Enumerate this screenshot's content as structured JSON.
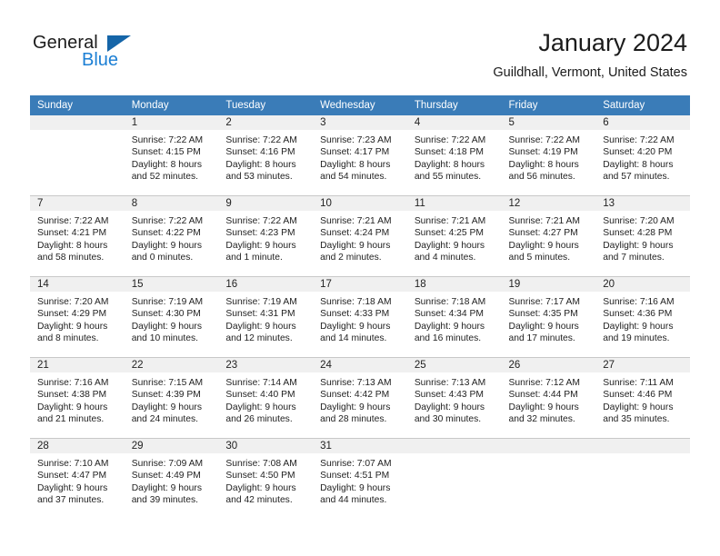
{
  "brand": {
    "name_part1": "General",
    "name_part2": "Blue",
    "triangle_icon": "triangle-icon",
    "accent_dark": "#1565a8",
    "accent_light": "#1b7fd4"
  },
  "header": {
    "title": "January 2024",
    "subtitle": "Guildhall, Vermont, United States",
    "header_bg": "#3a7cb8"
  },
  "weekday_headers": [
    "Sunday",
    "Monday",
    "Tuesday",
    "Wednesday",
    "Thursday",
    "Friday",
    "Saturday"
  ],
  "weeks": [
    [
      {
        "day": "",
        "sunrise": "",
        "sunset": "",
        "daylight_line1": "",
        "daylight_line2": ""
      },
      {
        "day": "1",
        "sunrise": "Sunrise: 7:22 AM",
        "sunset": "Sunset: 4:15 PM",
        "daylight_line1": "Daylight: 8 hours",
        "daylight_line2": "and 52 minutes."
      },
      {
        "day": "2",
        "sunrise": "Sunrise: 7:22 AM",
        "sunset": "Sunset: 4:16 PM",
        "daylight_line1": "Daylight: 8 hours",
        "daylight_line2": "and 53 minutes."
      },
      {
        "day": "3",
        "sunrise": "Sunrise: 7:23 AM",
        "sunset": "Sunset: 4:17 PM",
        "daylight_line1": "Daylight: 8 hours",
        "daylight_line2": "and 54 minutes."
      },
      {
        "day": "4",
        "sunrise": "Sunrise: 7:22 AM",
        "sunset": "Sunset: 4:18 PM",
        "daylight_line1": "Daylight: 8 hours",
        "daylight_line2": "and 55 minutes."
      },
      {
        "day": "5",
        "sunrise": "Sunrise: 7:22 AM",
        "sunset": "Sunset: 4:19 PM",
        "daylight_line1": "Daylight: 8 hours",
        "daylight_line2": "and 56 minutes."
      },
      {
        "day": "6",
        "sunrise": "Sunrise: 7:22 AM",
        "sunset": "Sunset: 4:20 PM",
        "daylight_line1": "Daylight: 8 hours",
        "daylight_line2": "and 57 minutes."
      }
    ],
    [
      {
        "day": "7",
        "sunrise": "Sunrise: 7:22 AM",
        "sunset": "Sunset: 4:21 PM",
        "daylight_line1": "Daylight: 8 hours",
        "daylight_line2": "and 58 minutes."
      },
      {
        "day": "8",
        "sunrise": "Sunrise: 7:22 AM",
        "sunset": "Sunset: 4:22 PM",
        "daylight_line1": "Daylight: 9 hours",
        "daylight_line2": "and 0 minutes."
      },
      {
        "day": "9",
        "sunrise": "Sunrise: 7:22 AM",
        "sunset": "Sunset: 4:23 PM",
        "daylight_line1": "Daylight: 9 hours",
        "daylight_line2": "and 1 minute."
      },
      {
        "day": "10",
        "sunrise": "Sunrise: 7:21 AM",
        "sunset": "Sunset: 4:24 PM",
        "daylight_line1": "Daylight: 9 hours",
        "daylight_line2": "and 2 minutes."
      },
      {
        "day": "11",
        "sunrise": "Sunrise: 7:21 AM",
        "sunset": "Sunset: 4:25 PM",
        "daylight_line1": "Daylight: 9 hours",
        "daylight_line2": "and 4 minutes."
      },
      {
        "day": "12",
        "sunrise": "Sunrise: 7:21 AM",
        "sunset": "Sunset: 4:27 PM",
        "daylight_line1": "Daylight: 9 hours",
        "daylight_line2": "and 5 minutes."
      },
      {
        "day": "13",
        "sunrise": "Sunrise: 7:20 AM",
        "sunset": "Sunset: 4:28 PM",
        "daylight_line1": "Daylight: 9 hours",
        "daylight_line2": "and 7 minutes."
      }
    ],
    [
      {
        "day": "14",
        "sunrise": "Sunrise: 7:20 AM",
        "sunset": "Sunset: 4:29 PM",
        "daylight_line1": "Daylight: 9 hours",
        "daylight_line2": "and 8 minutes."
      },
      {
        "day": "15",
        "sunrise": "Sunrise: 7:19 AM",
        "sunset": "Sunset: 4:30 PM",
        "daylight_line1": "Daylight: 9 hours",
        "daylight_line2": "and 10 minutes."
      },
      {
        "day": "16",
        "sunrise": "Sunrise: 7:19 AM",
        "sunset": "Sunset: 4:31 PM",
        "daylight_line1": "Daylight: 9 hours",
        "daylight_line2": "and 12 minutes."
      },
      {
        "day": "17",
        "sunrise": "Sunrise: 7:18 AM",
        "sunset": "Sunset: 4:33 PM",
        "daylight_line1": "Daylight: 9 hours",
        "daylight_line2": "and 14 minutes."
      },
      {
        "day": "18",
        "sunrise": "Sunrise: 7:18 AM",
        "sunset": "Sunset: 4:34 PM",
        "daylight_line1": "Daylight: 9 hours",
        "daylight_line2": "and 16 minutes."
      },
      {
        "day": "19",
        "sunrise": "Sunrise: 7:17 AM",
        "sunset": "Sunset: 4:35 PM",
        "daylight_line1": "Daylight: 9 hours",
        "daylight_line2": "and 17 minutes."
      },
      {
        "day": "20",
        "sunrise": "Sunrise: 7:16 AM",
        "sunset": "Sunset: 4:36 PM",
        "daylight_line1": "Daylight: 9 hours",
        "daylight_line2": "and 19 minutes."
      }
    ],
    [
      {
        "day": "21",
        "sunrise": "Sunrise: 7:16 AM",
        "sunset": "Sunset: 4:38 PM",
        "daylight_line1": "Daylight: 9 hours",
        "daylight_line2": "and 21 minutes."
      },
      {
        "day": "22",
        "sunrise": "Sunrise: 7:15 AM",
        "sunset": "Sunset: 4:39 PM",
        "daylight_line1": "Daylight: 9 hours",
        "daylight_line2": "and 24 minutes."
      },
      {
        "day": "23",
        "sunrise": "Sunrise: 7:14 AM",
        "sunset": "Sunset: 4:40 PM",
        "daylight_line1": "Daylight: 9 hours",
        "daylight_line2": "and 26 minutes."
      },
      {
        "day": "24",
        "sunrise": "Sunrise: 7:13 AM",
        "sunset": "Sunset: 4:42 PM",
        "daylight_line1": "Daylight: 9 hours",
        "daylight_line2": "and 28 minutes."
      },
      {
        "day": "25",
        "sunrise": "Sunrise: 7:13 AM",
        "sunset": "Sunset: 4:43 PM",
        "daylight_line1": "Daylight: 9 hours",
        "daylight_line2": "and 30 minutes."
      },
      {
        "day": "26",
        "sunrise": "Sunrise: 7:12 AM",
        "sunset": "Sunset: 4:44 PM",
        "daylight_line1": "Daylight: 9 hours",
        "daylight_line2": "and 32 minutes."
      },
      {
        "day": "27",
        "sunrise": "Sunrise: 7:11 AM",
        "sunset": "Sunset: 4:46 PM",
        "daylight_line1": "Daylight: 9 hours",
        "daylight_line2": "and 35 minutes."
      }
    ],
    [
      {
        "day": "28",
        "sunrise": "Sunrise: 7:10 AM",
        "sunset": "Sunset: 4:47 PM",
        "daylight_line1": "Daylight: 9 hours",
        "daylight_line2": "and 37 minutes."
      },
      {
        "day": "29",
        "sunrise": "Sunrise: 7:09 AM",
        "sunset": "Sunset: 4:49 PM",
        "daylight_line1": "Daylight: 9 hours",
        "daylight_line2": "and 39 minutes."
      },
      {
        "day": "30",
        "sunrise": "Sunrise: 7:08 AM",
        "sunset": "Sunset: 4:50 PM",
        "daylight_line1": "Daylight: 9 hours",
        "daylight_line2": "and 42 minutes."
      },
      {
        "day": "31",
        "sunrise": "Sunrise: 7:07 AM",
        "sunset": "Sunset: 4:51 PM",
        "daylight_line1": "Daylight: 9 hours",
        "daylight_line2": "and 44 minutes."
      },
      {
        "day": "",
        "sunrise": "",
        "sunset": "",
        "daylight_line1": "",
        "daylight_line2": ""
      },
      {
        "day": "",
        "sunrise": "",
        "sunset": "",
        "daylight_line1": "",
        "daylight_line2": ""
      },
      {
        "day": "",
        "sunrise": "",
        "sunset": "",
        "daylight_line1": "",
        "daylight_line2": ""
      }
    ]
  ]
}
